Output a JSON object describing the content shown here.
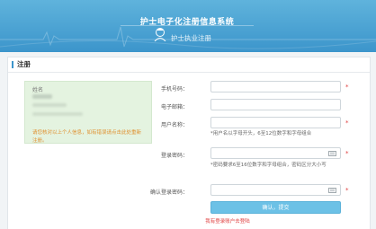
{
  "header": {
    "title": "护士电子化注册信息系统",
    "subtitle": "护士执业注册",
    "colors": {
      "banner_top": "#5fb3dc",
      "banner_bottom": "#3c95cb"
    }
  },
  "section": {
    "title": "注册"
  },
  "info_panel": {
    "name_label": "姓名",
    "note": "请您核对以上个人信息，如有错误请点击此处重新注册。"
  },
  "form": {
    "phone_label": "手机号码：",
    "phone_value": "",
    "email_label": "电子邮箱：",
    "email_value": "",
    "username_label": "用户名称：",
    "username_value": "",
    "username_hint": "*用户名以字母开头，6至12位数字和字母组合",
    "password_label": "登录密码：",
    "password_value": "",
    "password_hint": "*密码要求6至16位数字和字母组合，密码区分大小写",
    "confirm_label": "确认登录密码：",
    "confirm_value": "",
    "required_mark": "*",
    "submit_label": "确认，提交",
    "login_link": "我有登录账户去登陆"
  },
  "icons": {
    "nurse": "nurse-icon",
    "keyboard": "keyboard-icon"
  }
}
